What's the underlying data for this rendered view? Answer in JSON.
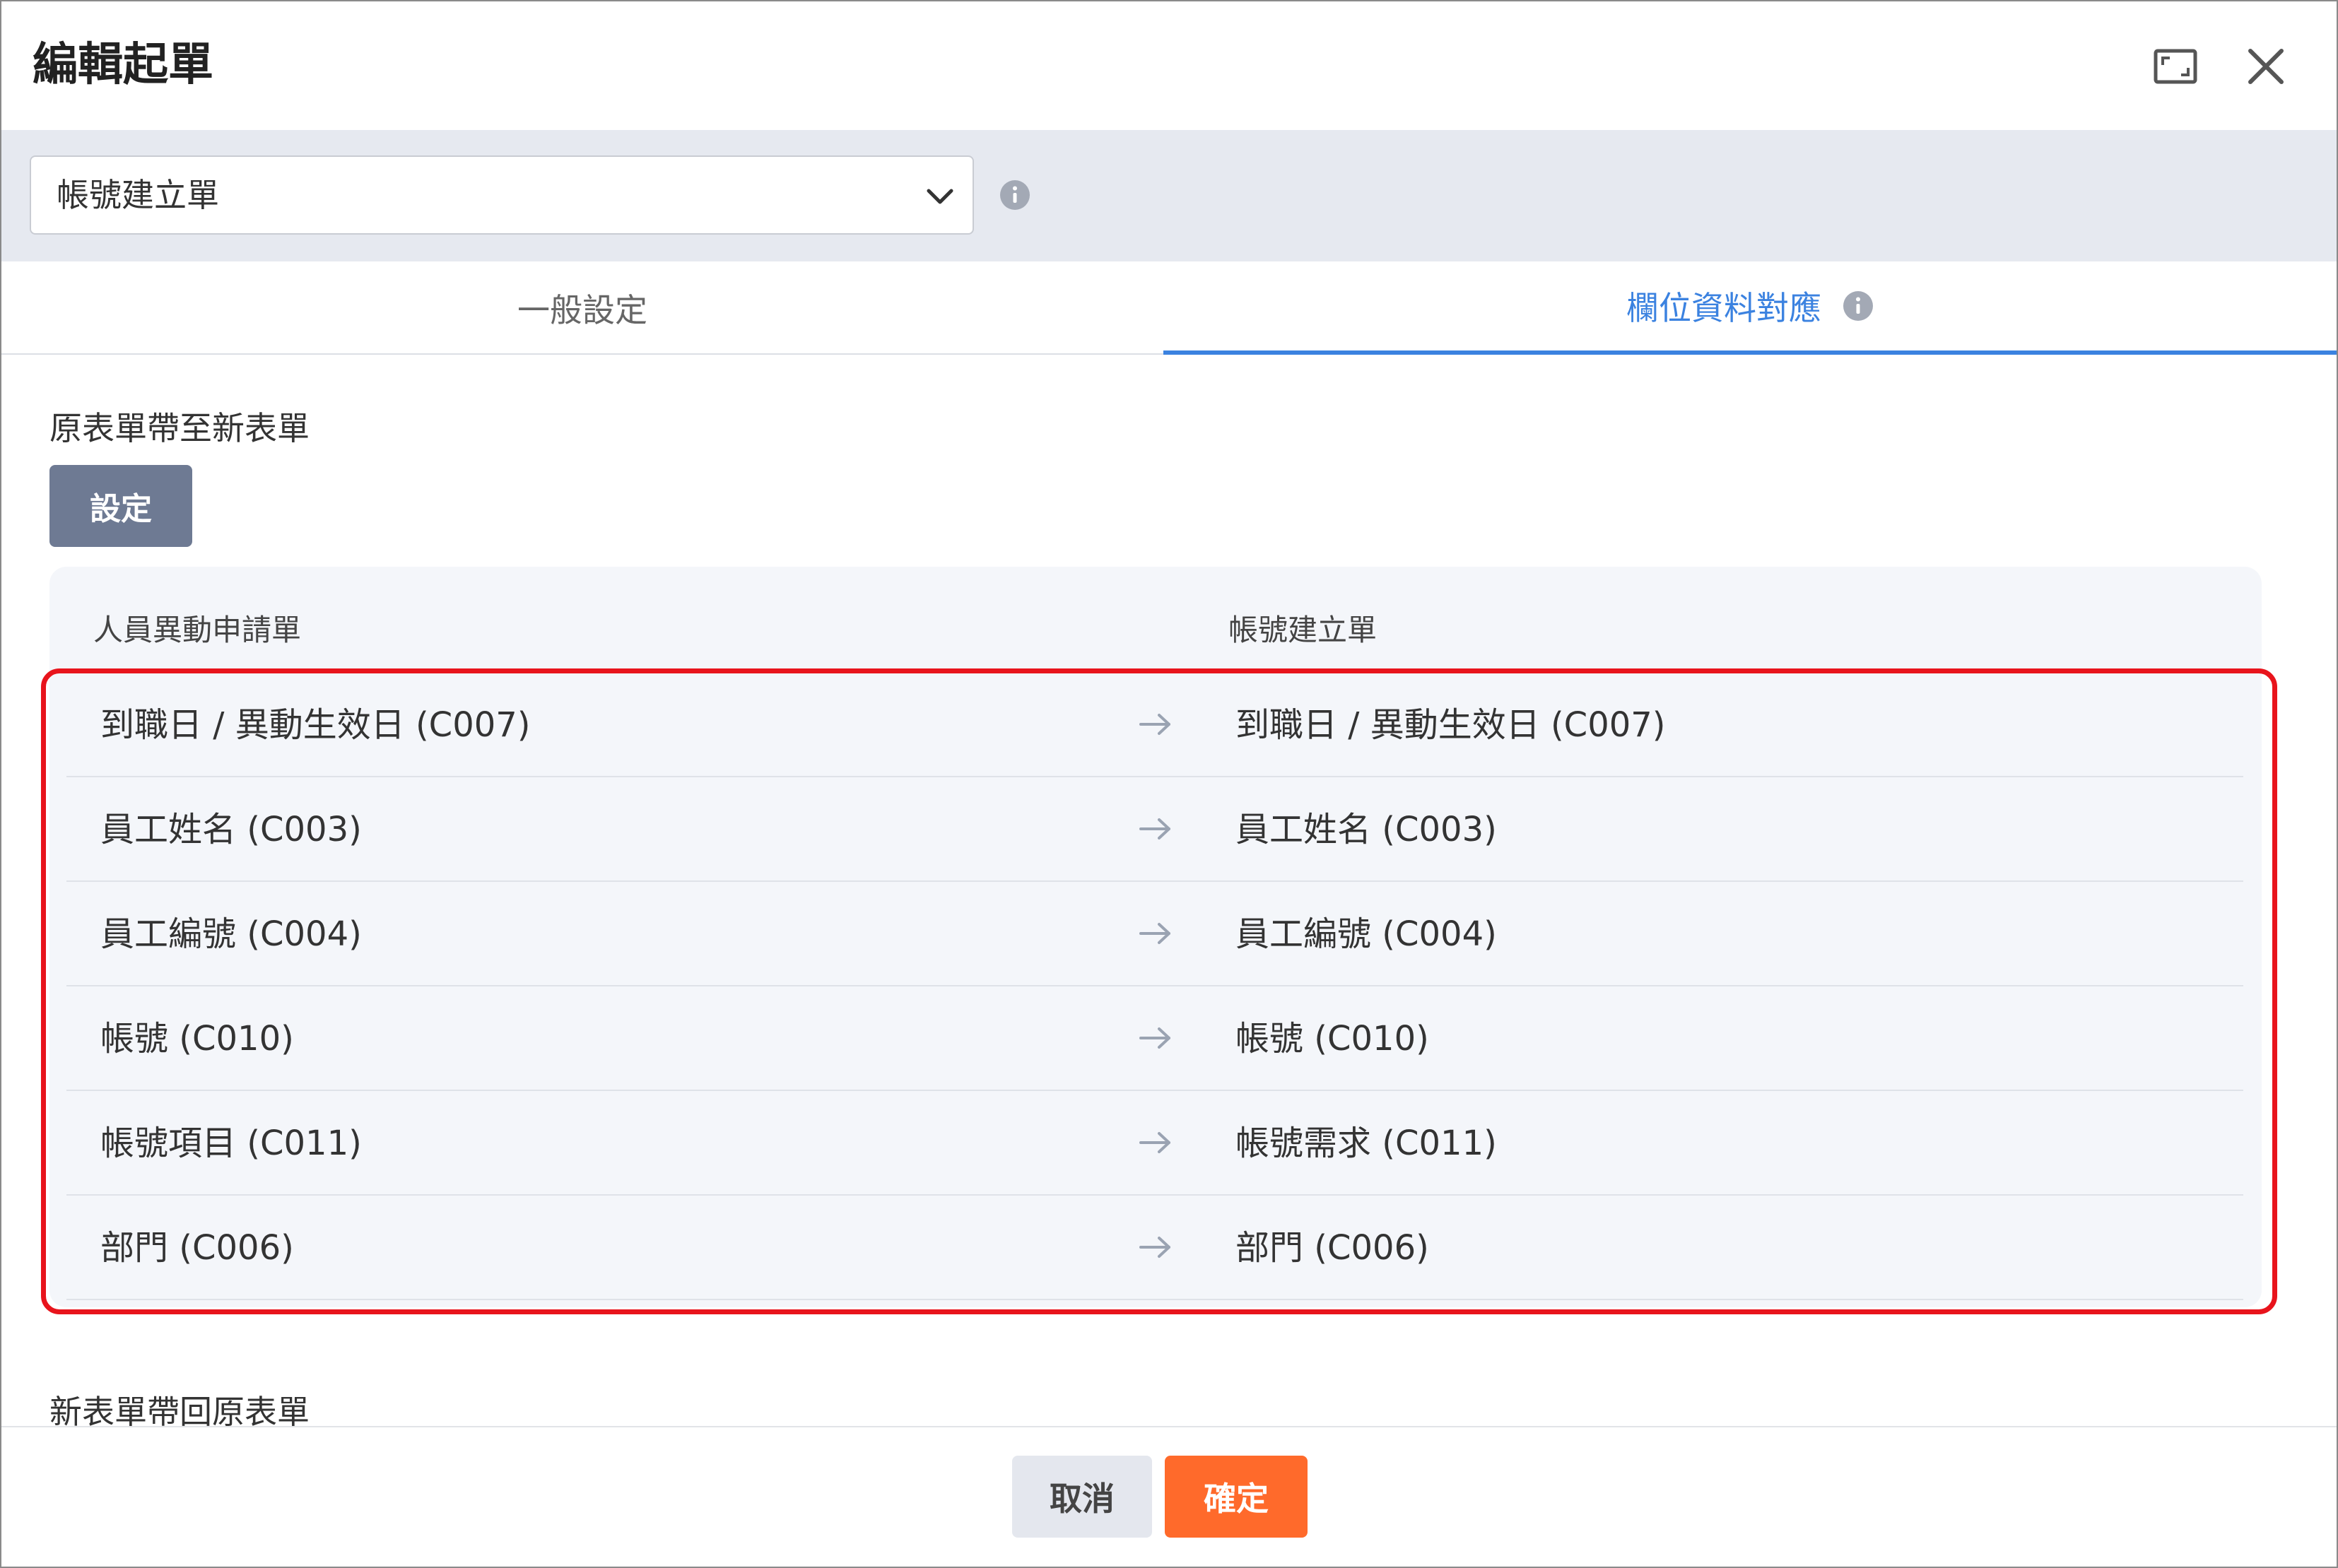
{
  "dialog": {
    "title": "編輯起單"
  },
  "selector": {
    "value": "帳號建立單"
  },
  "tabs": [
    {
      "label": "一般設定",
      "active": false
    },
    {
      "label": "欄位資料對應",
      "active": true
    }
  ],
  "sections": {
    "forward_label": "原表單帶至新表單",
    "settings_button": "設定",
    "backward_label": "新表單帶回原表單"
  },
  "mapping": {
    "source_header": "人員異動申請單",
    "target_header": "帳號建立單",
    "rows": [
      {
        "source": "到職日 / 異動生效日 (C007)",
        "target": "到職日 / 異動生效日 (C007)"
      },
      {
        "source": "員工姓名 (C003)",
        "target": "員工姓名 (C003)"
      },
      {
        "source": "員工編號 (C004)",
        "target": "員工編號 (C004)"
      },
      {
        "source": "帳號 (C010)",
        "target": "帳號 (C010)"
      },
      {
        "source": "帳號項目 (C011)",
        "target": "帳號需求 (C011)"
      },
      {
        "source": "部門 (C006)",
        "target": "部門 (C006)"
      }
    ]
  },
  "footer": {
    "cancel_label": "取消",
    "ok_label": "確定"
  },
  "icons": {
    "maximize": "maximize-icon",
    "close": "close-icon",
    "info": "info-icon",
    "chevron": "chevron-down-icon",
    "arrow": "arrow-right-icon"
  },
  "colors": {
    "accent": "#3b82e0",
    "primary_button": "#ff6a2b",
    "highlight": "#e8141c",
    "settings_button": "#6e7a93"
  }
}
